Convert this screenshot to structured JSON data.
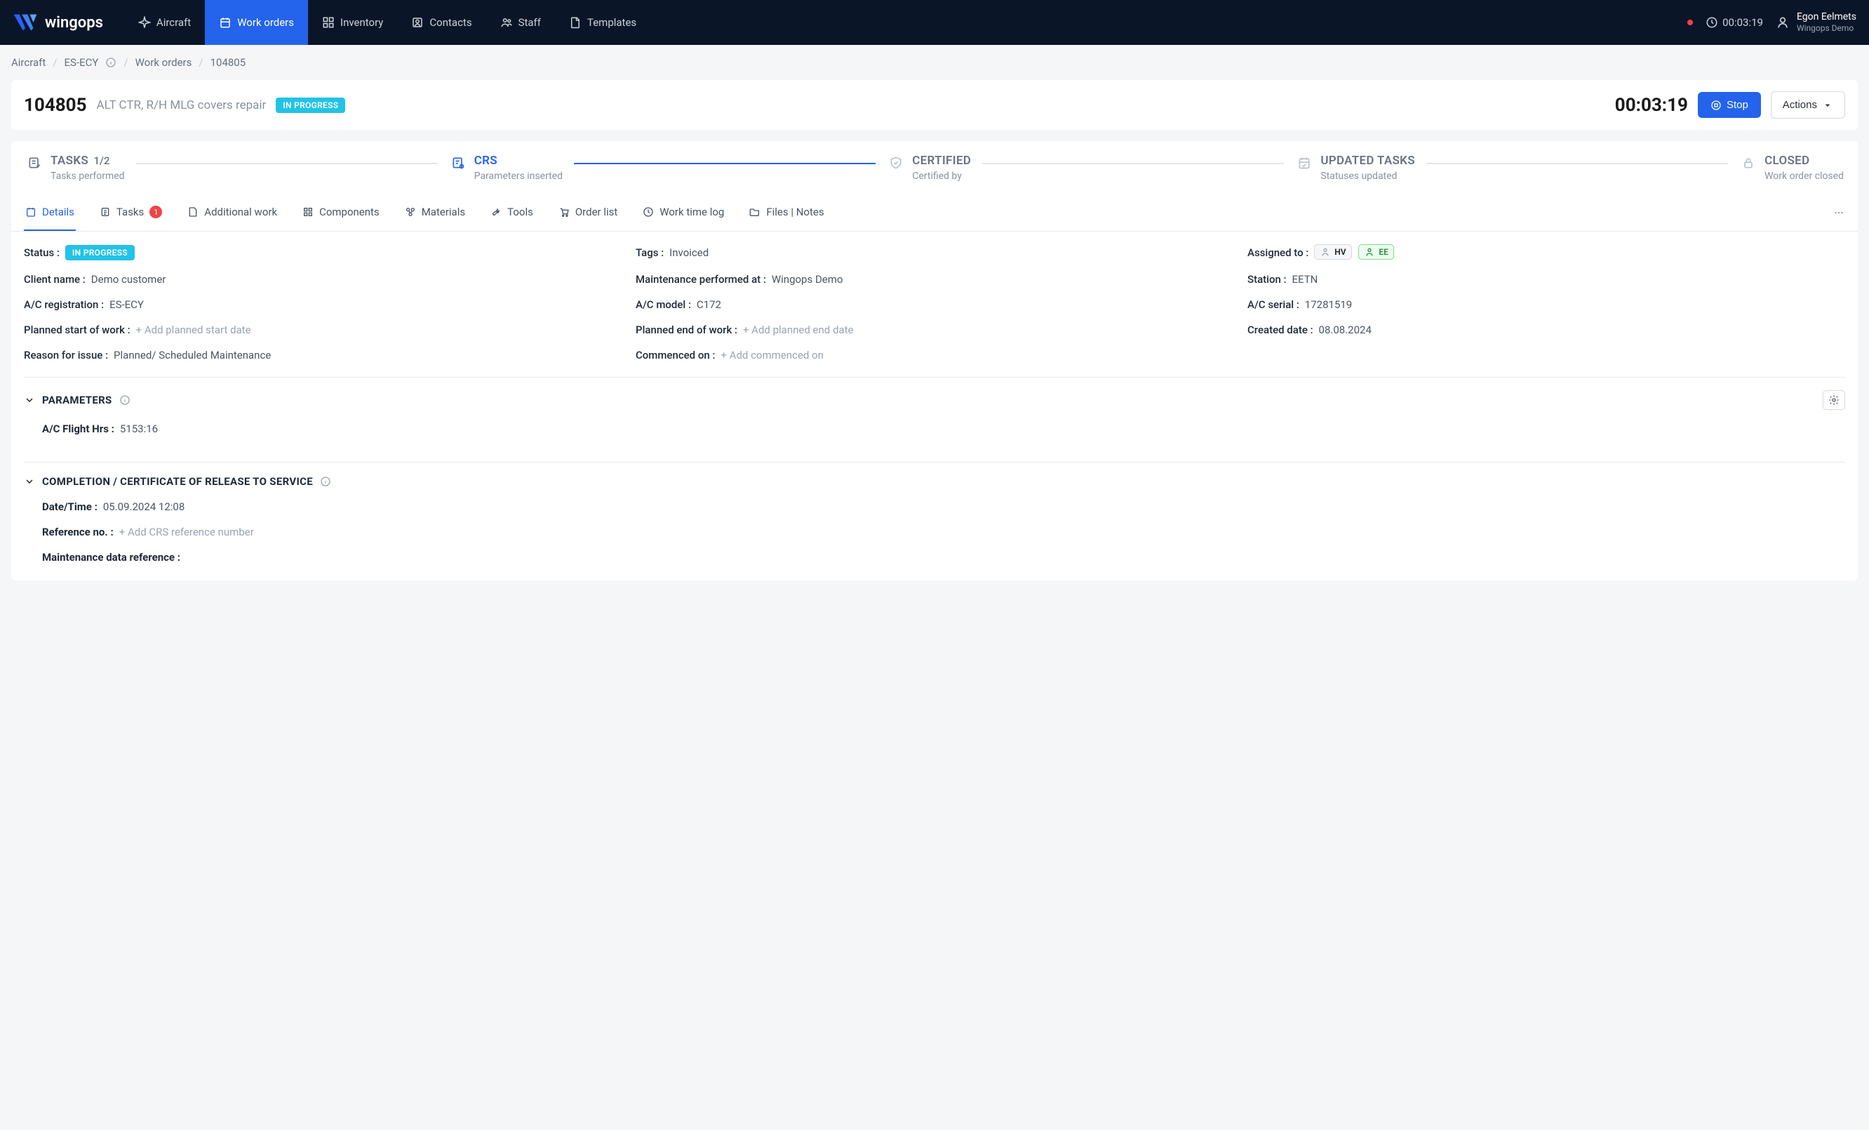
{
  "brand": {
    "name": "wingops"
  },
  "nav": {
    "aircraft": "Aircraft",
    "work_orders": "Work orders",
    "inventory": "Inventory",
    "contacts": "Contacts",
    "staff": "Staff",
    "templates": "Templates"
  },
  "topbar": {
    "timer": "00:03:19",
    "user_name": "Egon Eelmets",
    "user_org": "Wingops Demo"
  },
  "breadcrumb": {
    "aircraft": "Aircraft",
    "reg": "ES-ECY",
    "work_orders": "Work orders",
    "id": "104805"
  },
  "titlebar": {
    "id": "104805",
    "desc": "ALT CTR, R/H MLG covers repair",
    "badge": "IN PROGRESS",
    "timer": "00:03:19",
    "stop": "Stop",
    "actions": "Actions"
  },
  "stepper": {
    "tasks": {
      "label": "TASKS",
      "count": "1/2",
      "sub": "Tasks performed"
    },
    "crs": {
      "label": "CRS",
      "sub": "Parameters inserted"
    },
    "certified": {
      "label": "CERTIFIED",
      "sub": "Certified by"
    },
    "updated": {
      "label": "UPDATED TASKS",
      "sub": "Statuses updated"
    },
    "closed": {
      "label": "CLOSED",
      "sub": "Work order closed"
    }
  },
  "tabs": {
    "details": "Details",
    "tasks": "Tasks",
    "tasks_badge": "1",
    "additional_work": "Additional work",
    "components": "Components",
    "materials": "Materials",
    "tools": "Tools",
    "order_list": "Order list",
    "work_time_log": "Work time log",
    "files_notes": "Files | Notes"
  },
  "details": {
    "status_label": "Status",
    "status_value": "IN PROGRESS",
    "tags_label": "Tags",
    "tags_value": "Invoiced",
    "assigned_label": "Assigned to",
    "assignee1": "HV",
    "assignee2": "EE",
    "client_label": "Client name",
    "client_value": "Demo customer",
    "maint_at_label": "Maintenance performed at",
    "maint_at_value": "Wingops Demo",
    "station_label": "Station",
    "station_value": "EETN",
    "ac_reg_label": "A/C registration",
    "ac_reg_value": "ES-ECY",
    "ac_model_label": "A/C model",
    "ac_model_value": "C172",
    "ac_serial_label": "A/C serial",
    "ac_serial_value": "17281519",
    "planned_start_label": "Planned start of work",
    "planned_start_placeholder": "+ Add planned start date",
    "planned_end_label": "Planned end of work",
    "planned_end_placeholder": "+ Add planned end date",
    "created_label": "Created date",
    "created_value": "08.08.2024",
    "reason_label": "Reason for issue",
    "reason_value": "Planned/ Scheduled Maintenance",
    "commenced_label": "Commenced on",
    "commenced_placeholder": "+ Add commenced on"
  },
  "parameters": {
    "section": "PARAMETERS",
    "fh_label": "A/C Flight Hrs",
    "fh_value": "5153:16"
  },
  "crs_section": {
    "section": "COMPLETION / CERTIFICATE OF RELEASE TO SERVICE",
    "datetime_label": "Date/Time",
    "datetime_value": "05.09.2024 12:08",
    "refno_label": "Reference no.",
    "refno_placeholder": "+ Add CRS reference number",
    "maint_data_label": "Maintenance data reference"
  }
}
